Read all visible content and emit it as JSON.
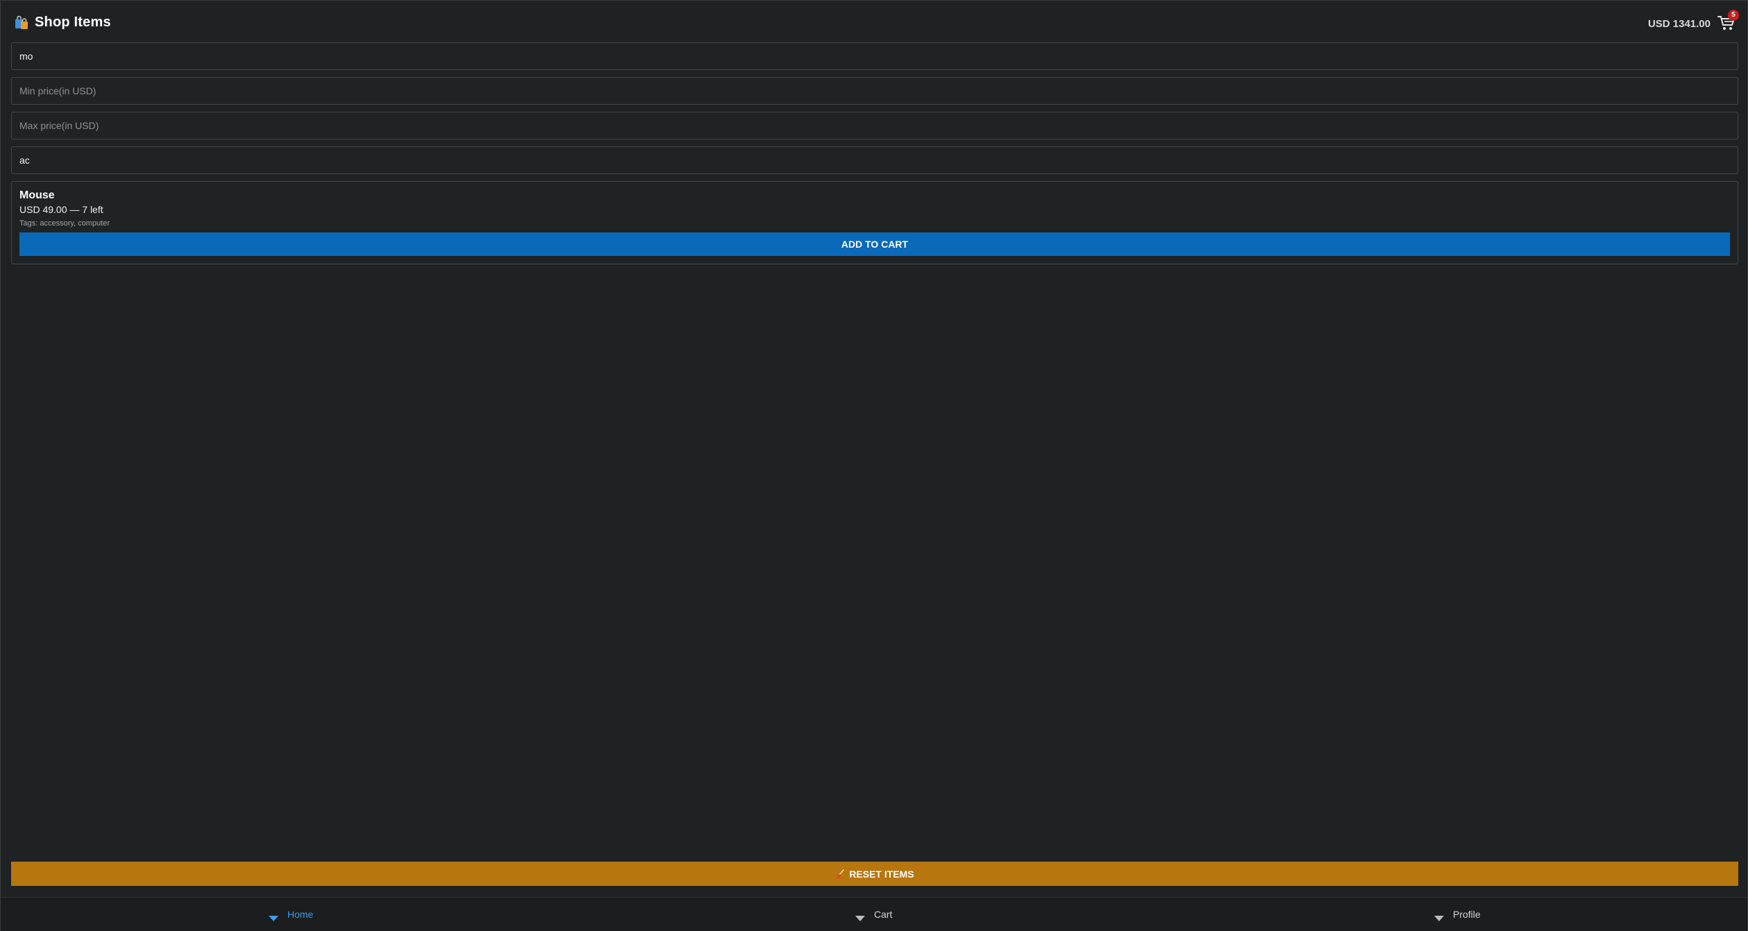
{
  "header": {
    "title": "Shop Items",
    "balance": "USD 1341.00",
    "cart_count": "5"
  },
  "filters": {
    "search_value": "mo",
    "min_price_placeholder": "Min price(in USD)",
    "max_price_placeholder": "Max price(in USD)",
    "tag_value": "ac"
  },
  "products": [
    {
      "name": "Mouse",
      "price_stock": "USD 49.00 — 7 left",
      "tags": "Tags: accessory, computer",
      "add_label": "ADD TO CART"
    }
  ],
  "actions": {
    "reset_label": "RESET ITEMS"
  },
  "nav": {
    "items": [
      {
        "label": "Home",
        "active": true
      },
      {
        "label": "Cart",
        "active": false
      },
      {
        "label": "Profile",
        "active": false
      }
    ]
  },
  "colors": {
    "background": "#1f2223",
    "primary": "#0a69b8",
    "reset": "#b8760e",
    "badge": "#c81e1e",
    "nav_active": "#3b9cf0"
  },
  "icons": {
    "title": "shopping-bags-icon",
    "cart": "cart-icon",
    "reset": "broom-icon",
    "nav": "triangle-down-icon"
  }
}
